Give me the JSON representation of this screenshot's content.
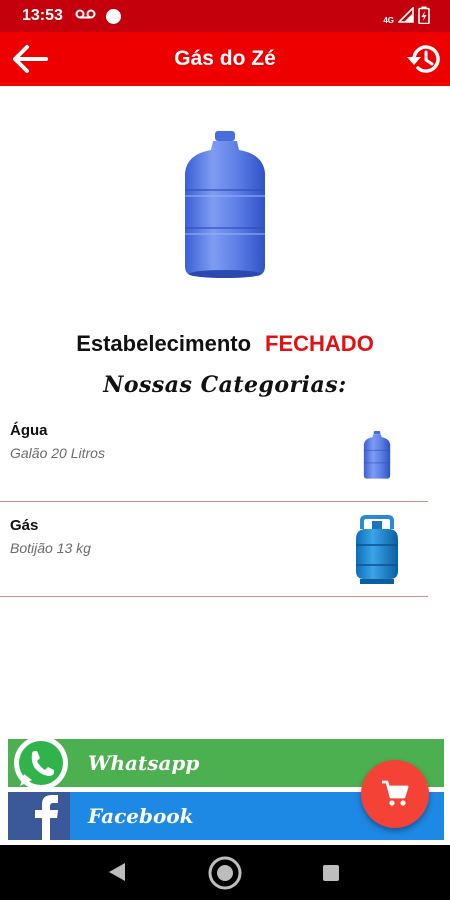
{
  "status_bar": {
    "time": "13:53",
    "network": "4G"
  },
  "app_bar": {
    "title": "Gás do Zé",
    "back_icon": "arrow-left-icon",
    "history_icon": "history-icon"
  },
  "hero": {
    "icon": "water-gallon-icon"
  },
  "store_status": {
    "label": "Estabelecimento",
    "value": "FECHADO",
    "value_color": "#e21212"
  },
  "categories": {
    "title": "Nossas Categorias:",
    "items": [
      {
        "name": "Água",
        "description": "Galão 20 Litros",
        "icon": "water-gallon-icon"
      },
      {
        "name": "Gás",
        "description": "Botijão 13 kg",
        "icon": "gas-cylinder-icon"
      }
    ]
  },
  "social": {
    "whatsapp_label": "Whatsapp",
    "facebook_label": "Facebook",
    "whatsapp_color": "#4caf50",
    "facebook_color": "#1e88e5"
  },
  "cart_button": {
    "icon": "cart-icon",
    "color": "#f44336"
  },
  "colors": {
    "status_bar": "#c4000c",
    "app_bar": "#ee0000",
    "divider": "#d98a8a"
  }
}
